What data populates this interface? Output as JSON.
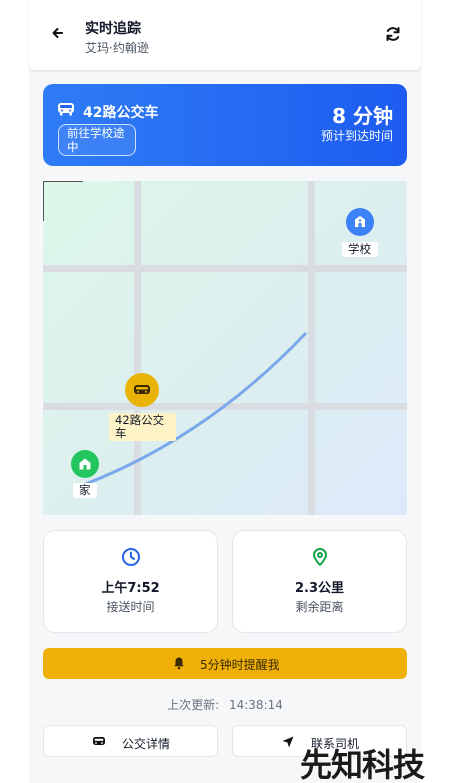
{
  "header": {
    "title": "实时追踪",
    "subtitle": "艾玛·约翰逊"
  },
  "status": {
    "route_name": "42路公交车",
    "route_badge": "前往学校途中",
    "eta_value": "8 分钟",
    "eta_label": "预计到达时间",
    "accent_color": "#2563eb"
  },
  "map": {
    "school_label": "学校",
    "bus_label": "42路公交车",
    "home_label": "家",
    "school_color": "#3b82f6",
    "bus_color": "#eab308",
    "home_color": "#22c55e",
    "route_color": "#7aa8ea"
  },
  "info": {
    "pickup_time": "上午7:52",
    "pickup_label": "接送时间",
    "distance": "2.3公里",
    "distance_label": "剩余距离"
  },
  "reminder": {
    "label": "5分钟时提醒我",
    "color": "#efb009"
  },
  "update": {
    "label": "上次更新:",
    "time": "14:38:14"
  },
  "actions": {
    "bus_details": "公交详情",
    "contact_driver": "联系司机"
  },
  "watermark": {
    "text": "先知科技"
  }
}
